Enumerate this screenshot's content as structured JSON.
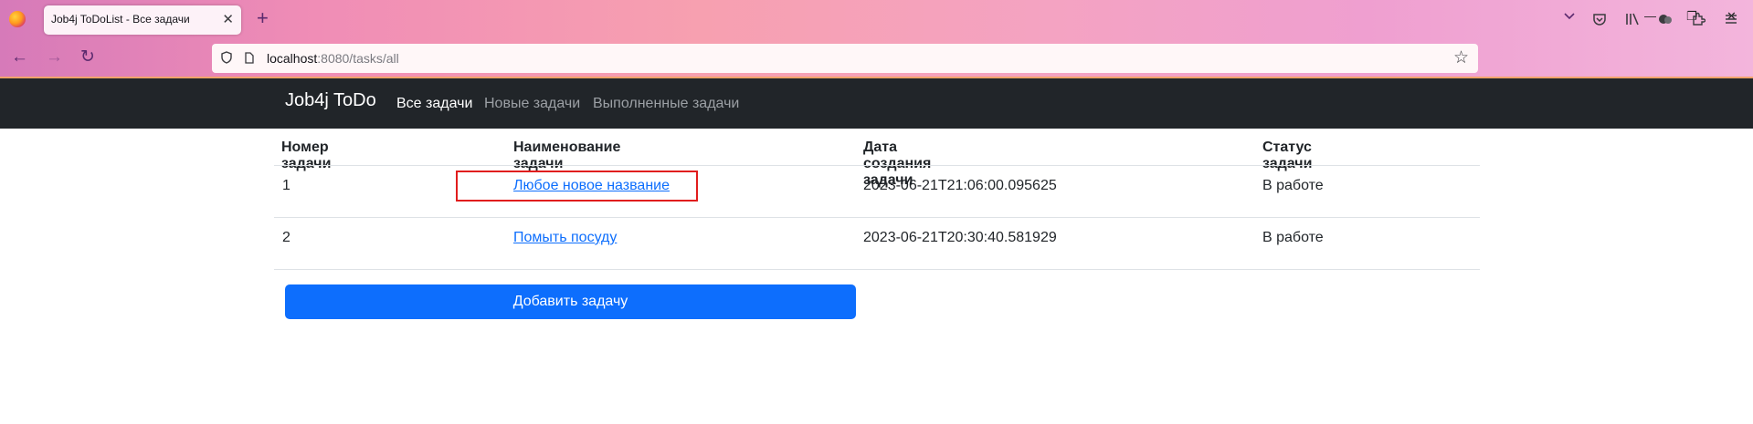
{
  "browser": {
    "tab_title": "Job4j ToDoList - Все задачи",
    "tab_close": "✕",
    "new_tab": "+",
    "url_host": "localhost",
    "url_rest": ":8080/tasks/all",
    "window_min": "—",
    "window_restore": "❐",
    "window_close": "✕",
    "star": "☆",
    "back": "←",
    "forward": "→",
    "reload": "↻"
  },
  "navbar": {
    "brand": "Job4j ToDo",
    "links": [
      "Все задачи",
      "Новые задачи",
      "Выполненные задачи"
    ],
    "active_index": 0
  },
  "table": {
    "headers": [
      "Номер задачи",
      "Наименование задачи",
      "Дата создания задачи",
      "Статус задачи"
    ],
    "rows": [
      {
        "id": "1",
        "name": "Любое новое название",
        "created": "2023-06-21T21:06:00.095625",
        "status": "В работе"
      },
      {
        "id": "2",
        "name": "Помыть посуду",
        "created": "2023-06-21T20:30:40.581929",
        "status": "В работе"
      }
    ]
  },
  "add_button": "Добавить задачу",
  "colors": {
    "navbar_bg": "#212529",
    "link": "#0d6efd",
    "primary_button": "#0d6efd",
    "highlight_box": "#e11d1d"
  }
}
